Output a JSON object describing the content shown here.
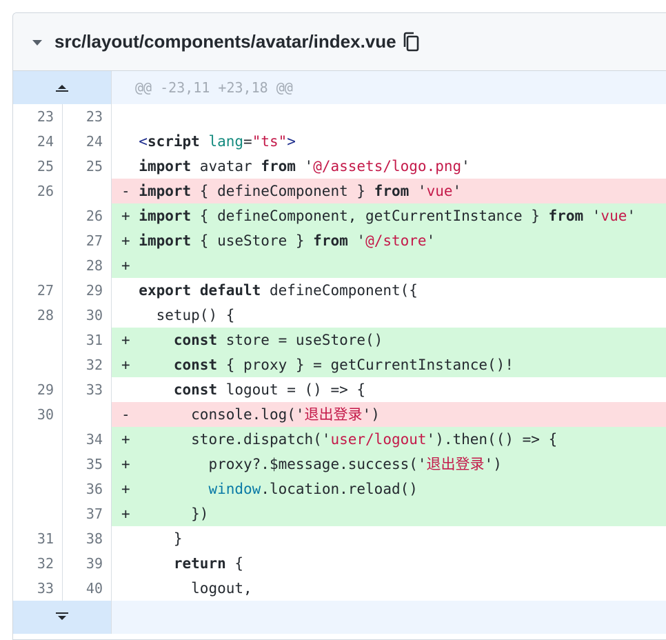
{
  "file": {
    "path": "src/layout/components/avatar/index.vue"
  },
  "hunk": {
    "header": "@@ -23,11 +23,18 @@"
  },
  "lines": [
    {
      "old": "23",
      "new": "23",
      "type": "ctx",
      "sign": " ",
      "text": ""
    },
    {
      "old": "24",
      "new": "24",
      "type": "ctx",
      "sign": " ",
      "text": "<script lang=\"ts\">"
    },
    {
      "old": "25",
      "new": "25",
      "type": "ctx",
      "sign": " ",
      "text": "import avatar from '@/assets/logo.png'"
    },
    {
      "old": "26",
      "new": "",
      "type": "del",
      "sign": "-",
      "text": "import { defineComponent } from 'vue'"
    },
    {
      "old": "",
      "new": "26",
      "type": "add",
      "sign": "+",
      "text": "import { defineComponent, getCurrentInstance } from 'vue'"
    },
    {
      "old": "",
      "new": "27",
      "type": "add",
      "sign": "+",
      "text": "import { useStore } from '@/store'"
    },
    {
      "old": "",
      "new": "28",
      "type": "add",
      "sign": "+",
      "text": ""
    },
    {
      "old": "27",
      "new": "29",
      "type": "ctx",
      "sign": " ",
      "text": "export default defineComponent({"
    },
    {
      "old": "28",
      "new": "30",
      "type": "ctx",
      "sign": " ",
      "text": "  setup() {"
    },
    {
      "old": "",
      "new": "31",
      "type": "add",
      "sign": "+",
      "text": "    const store = useStore()"
    },
    {
      "old": "",
      "new": "32",
      "type": "add",
      "sign": "+",
      "text": "    const { proxy } = getCurrentInstance()!"
    },
    {
      "old": "29",
      "new": "33",
      "type": "ctx",
      "sign": " ",
      "text": "    const logout = () => {"
    },
    {
      "old": "30",
      "new": "",
      "type": "del",
      "sign": "-",
      "text": "      console.log('退出登录')"
    },
    {
      "old": "",
      "new": "34",
      "type": "add",
      "sign": "+",
      "text": "      store.dispatch('user/logout').then(() => {"
    },
    {
      "old": "",
      "new": "35",
      "type": "add",
      "sign": "+",
      "text": "        proxy?.$message.success('退出登录')"
    },
    {
      "old": "",
      "new": "36",
      "type": "add",
      "sign": "+",
      "text": "        window.location.reload()"
    },
    {
      "old": "",
      "new": "37",
      "type": "add",
      "sign": "+",
      "text": "      })"
    },
    {
      "old": "31",
      "new": "38",
      "type": "ctx",
      "sign": " ",
      "text": "    }"
    },
    {
      "old": "32",
      "new": "39",
      "type": "ctx",
      "sign": " ",
      "text": "    return {"
    },
    {
      "old": "33",
      "new": "40",
      "type": "ctx",
      "sign": " ",
      "text": "      logout,"
    }
  ],
  "icons": {
    "collapse": "chevron-down-icon",
    "copy": "copy-icon",
    "expand_up": "expand-up-icon",
    "expand_down": "expand-down-icon"
  },
  "colors": {
    "add_bg": "#d4f8dc",
    "del_bg": "#fddde0",
    "hunk_bg": "#eef5fe",
    "expander_bg": "#d6e8fb",
    "string": "#c41a4a",
    "keyword": "#24292f"
  }
}
